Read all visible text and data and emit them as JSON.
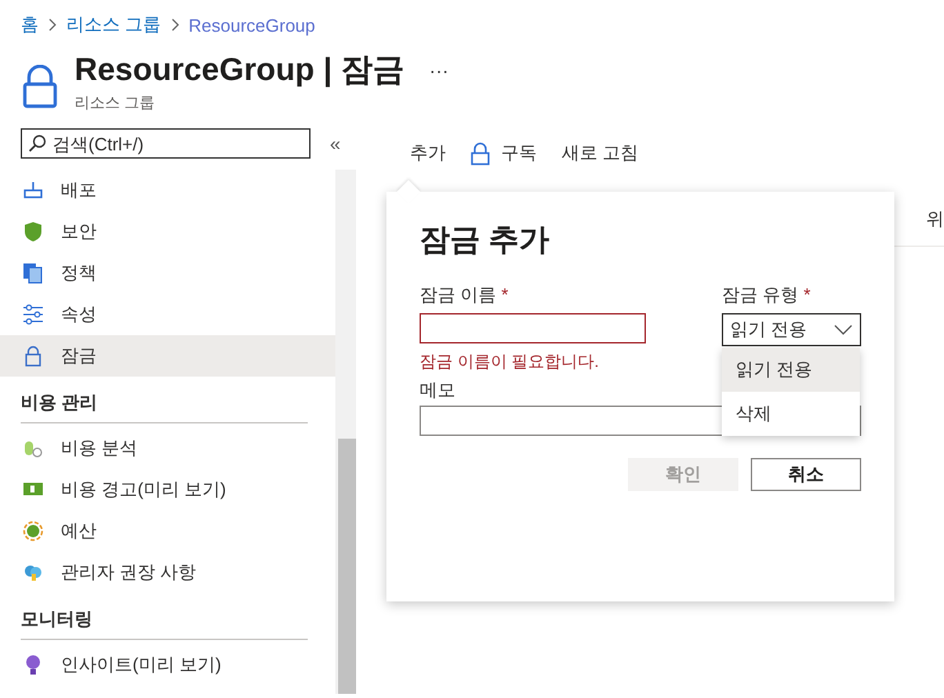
{
  "breadcrumb": [
    "홈",
    "리소스 그룹",
    "ResourceGroup"
  ],
  "header": {
    "title": "ResourceGroup | 잠금",
    "subtitle": "리소스 그룹",
    "more": "···"
  },
  "search": {
    "placeholder": "검색(Ctrl+/)"
  },
  "collapse": "«",
  "sidebar": {
    "items": [
      {
        "kind": "item",
        "label": "배포",
        "selected": false
      },
      {
        "kind": "item",
        "label": "보안",
        "selected": false
      },
      {
        "kind": "item",
        "label": "정책",
        "selected": false
      },
      {
        "kind": "item",
        "label": "속성",
        "selected": false
      },
      {
        "kind": "item",
        "label": "잠금",
        "selected": true
      },
      {
        "kind": "section",
        "label": "비용 관리"
      },
      {
        "kind": "item",
        "label": "비용 분석",
        "selected": false
      },
      {
        "kind": "item",
        "label": "비용 경고(미리 보기)",
        "selected": false
      },
      {
        "kind": "item",
        "label": "예산",
        "selected": false
      },
      {
        "kind": "item",
        "label": "관리자 권장 사항",
        "selected": false
      },
      {
        "kind": "section",
        "label": "모니터링"
      },
      {
        "kind": "item",
        "label": "인사이트(미리 보기)",
        "selected": false
      }
    ]
  },
  "toolbar": [
    {
      "kind": "text",
      "label": "추가"
    },
    {
      "kind": "lock",
      "label": "구독"
    },
    {
      "kind": "text",
      "label": "새로 고침"
    }
  ],
  "behind_text": "위",
  "dialog": {
    "title": "잠금 추가",
    "name_field": {
      "label": "잠금 이름",
      "required": "*",
      "error": "잠금 이름이 필요합니다."
    },
    "type_field": {
      "label": "잠금 유형",
      "required": "*",
      "value": "읽기 전용",
      "expanded": true,
      "options": [
        {
          "label": "읽기 전용",
          "selected": true
        },
        {
          "label": "삭제",
          "selected": false
        }
      ]
    },
    "memo_field": {
      "label": "메모"
    },
    "buttons": [
      {
        "label": "확인",
        "disabled": true
      },
      {
        "label": "취소",
        "disabled": false
      }
    ]
  }
}
